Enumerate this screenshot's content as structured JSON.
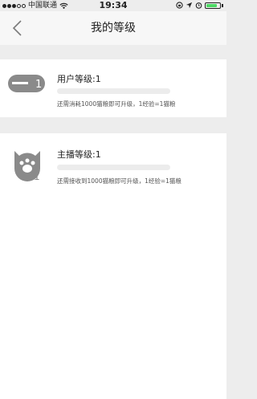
{
  "status_bar": {
    "carrier": "中国联通",
    "time": "19:34",
    "signal_dots_filled": 3,
    "signal_dots_total": 5,
    "battery_level": 0.8,
    "battery_color": "#4cd964"
  },
  "header": {
    "title": "我的等级",
    "back_icon": "chevron-left-icon"
  },
  "user_level": {
    "title": "用户等级:1",
    "progress": 0,
    "hint": "还需消耗1000猫粮即可升级，1经验=1猫粮",
    "badge_text": "1"
  },
  "anchor_level": {
    "title": "主播等级:1",
    "progress": 0,
    "hint": "还需接收到1000猫粮即可升级，1经验=1猫粮",
    "badge_text": "1"
  },
  "colors": {
    "background": "#ededed",
    "card": "#ffffff",
    "progress_track": "#ececec",
    "badge_gray": "#8a8a8a"
  }
}
